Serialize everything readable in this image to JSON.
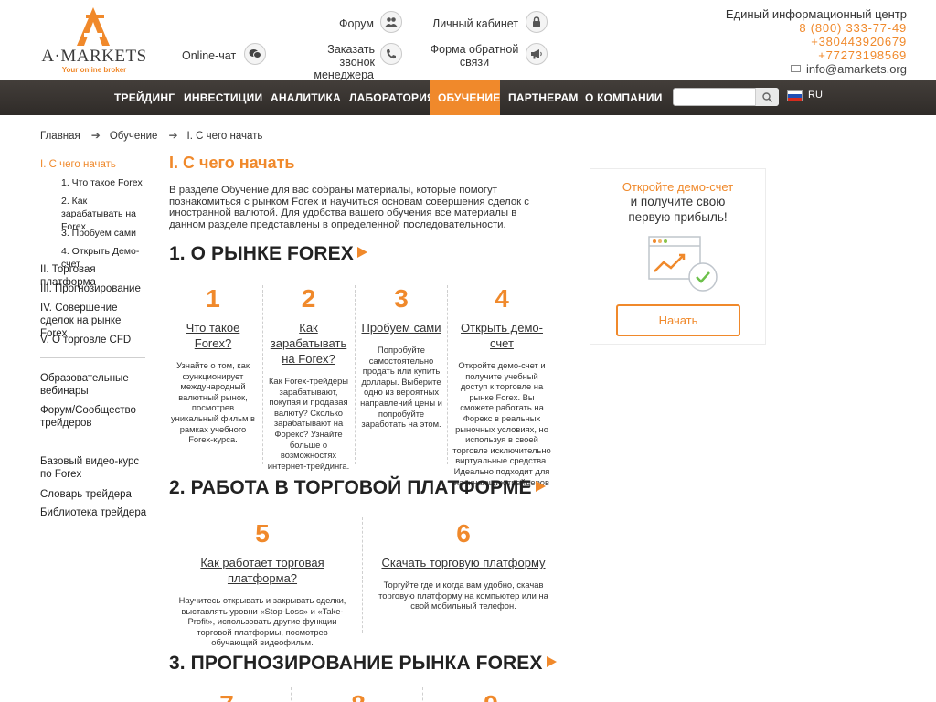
{
  "header": {
    "logo_text": "A·MARKETS",
    "logo_tagline": "Your online broker",
    "links": {
      "chat": "Online-чат",
      "forum": "Форум",
      "callback_line1": "Заказать звонок",
      "callback_line2": "менеджера",
      "cabinet": "Личный кабинет",
      "feedback_line1": "Форма обратной",
      "feedback_line2": "связи"
    },
    "info": {
      "title": "Единый информационный центр",
      "phones": [
        "8 (800) 333-77-49",
        "+380443920679",
        "+77273198569"
      ],
      "email": "info@amarkets.org"
    }
  },
  "nav": {
    "items": [
      "Трейдинг",
      "Инвестиции",
      "Аналитика",
      "Лаборатория",
      "Обучение",
      "Партнерам",
      "О компании"
    ],
    "active_index": 4,
    "search_placeholder": "",
    "lang": "RU"
  },
  "breadcrumb": [
    "Главная",
    "Обучение",
    "I. С чего начать"
  ],
  "sidebar": {
    "items": [
      {
        "label": "I. С чего начать",
        "active": true
      },
      {
        "label": "1. Что такое Forex",
        "sub": true
      },
      {
        "label": "2. Как зарабатывать на Forex",
        "sub": true
      },
      {
        "label": "3. Пробуем сами",
        "sub": true
      },
      {
        "label": "4. Открыть Демо-счет",
        "sub": true
      },
      {
        "label": "II. Торговая платформа"
      },
      {
        "label": "III. Прогнозирование"
      },
      {
        "label": "IV. Совершение сделок на рынке Forex"
      },
      {
        "label": "V. О торговле CFD"
      }
    ],
    "group2": [
      "Образовательные вебинары",
      "Форум/Сообщество трейдеров"
    ],
    "group3": [
      "Базовый видео-курс по Forex",
      "Словарь трейдера",
      "Библиотека трейдера"
    ]
  },
  "main": {
    "title": "I. С чего начать",
    "intro": "В разделе Обучение для вас собраны материалы, которые помогут познакомиться с рынком Forex и научиться основам совершения сделок с иностранной валютой. Для удобства вашего обучения все материалы в данном разделе представлены в определенной последовательности.",
    "sections": [
      {
        "title": "1. О РЫНКЕ FOREX",
        "cards": [
          {
            "num": "1",
            "link": "Что такое Forex?",
            "desc": "Узнайте о том, как функционирует международный валютный рынок, посмотрев уникальный фильм в рамках учебного Forex-курса."
          },
          {
            "num": "2",
            "link": "Как зарабатывать на Forex?",
            "desc": "Как Forex-трейдеры зарабатывают, покупая и продавая валюту? Сколько зарабатывают на Форекс? Узнайте больше о возможностях интернет-трейдинга."
          },
          {
            "num": "3",
            "link": "Пробуем сами",
            "desc": "Попробуйте самостоятельно продать или купить доллары. Выберите одно из вероятных направлений цены и попробуйте заработать на этом."
          },
          {
            "num": "4",
            "link": "Открыть демо-счет",
            "desc": "Откройте демо-счет и получите учебный доступ к торговле на рынке Forex. Вы сможете работать на Форекс в реальных рыночных условиях, но используя в своей торговле исключительно виртуальные средства. Идеально подходит для начинающих трейдеров"
          }
        ]
      },
      {
        "title": "2. РАБОТА В ТОРГОВОЙ ПЛАТФОРМЕ",
        "cards": [
          {
            "num": "5",
            "link": "Как работает торговая платформа?",
            "desc": "Научитесь открывать и закрывать сделки, выставлять уровни «Stop-Loss» и «Take-Profit», использовать другие функции торговой платформы, посмотрев обучающий видеофильм."
          },
          {
            "num": "6",
            "link": "Скачать торговую платформу",
            "desc": "Торгуйте где и когда вам удобно, скачав торговую платформу на компьютер или на свой мобильный телефон."
          }
        ]
      },
      {
        "title": "3. ПРОГНОЗИРОВАНИЕ РЫНКА FOREX",
        "cards": [
          {
            "num": "7"
          },
          {
            "num": "8"
          },
          {
            "num": "9"
          }
        ]
      }
    ]
  },
  "promo": {
    "line1": "Откройте демо-счет",
    "line2": "и получите свою",
    "line3": "первую прибыль!",
    "button": "Начать"
  },
  "colors": {
    "accent": "#f0892b",
    "nav_bg": "#3b3734"
  }
}
